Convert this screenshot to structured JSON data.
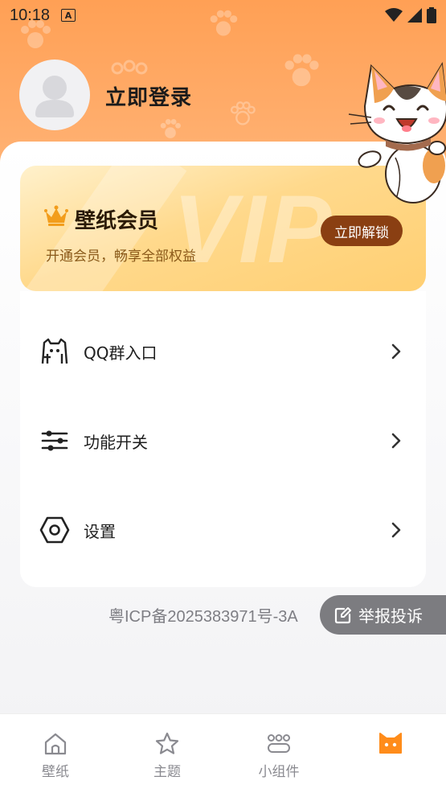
{
  "status_bar": {
    "time": "10:18",
    "notification_letter": "A"
  },
  "profile": {
    "login_text": "立即登录"
  },
  "vip": {
    "title": "壁纸会员",
    "subtitle": "开通会员，畅享全部权益",
    "unlock_button": "立即解锁",
    "watermark": "VIP"
  },
  "menu": [
    {
      "label": "QQ群入口",
      "icon": "qq-group-icon"
    },
    {
      "label": "功能开关",
      "icon": "sliders-icon"
    },
    {
      "label": "设置",
      "icon": "settings-hex-icon"
    }
  ],
  "footer": {
    "icp": "粤ICP备2025383971号-3A",
    "report_button": "举报投诉"
  },
  "tabs": [
    {
      "label": "壁纸",
      "icon": "home-icon",
      "active": false
    },
    {
      "label": "主题",
      "icon": "star-icon",
      "active": false
    },
    {
      "label": "小组件",
      "icon": "widgets-icon",
      "active": false
    },
    {
      "label": "",
      "icon": "cat-face-icon",
      "active": true
    }
  ],
  "colors": {
    "header_orange": "#ffa055",
    "vip_button": "#8a3f12",
    "tab_active": "#ff8c1a",
    "tab_inactive": "#8a8a90"
  }
}
